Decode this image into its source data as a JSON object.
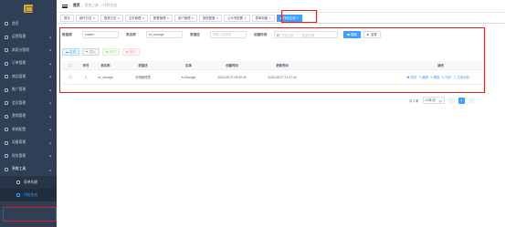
{
  "sidebar": {
    "items": [
      {
        "label": "首页",
        "expandable": false
      },
      {
        "label": "运营管理",
        "expandable": true
      },
      {
        "label": "商家分管理",
        "expandable": true
      },
      {
        "label": "订单管理",
        "expandable": true
      },
      {
        "label": "商品管理",
        "expandable": true
      },
      {
        "label": "推广管理",
        "expandable": true
      },
      {
        "label": "会员管理",
        "expandable": true
      },
      {
        "label": "营销管理",
        "expandable": true
      },
      {
        "label": "系统配置",
        "expandable": true
      },
      {
        "label": "设备管理",
        "expandable": true
      },
      {
        "label": "财务管理",
        "expandable": true
      },
      {
        "label": "系统工具",
        "expandable": true,
        "open": true
      }
    ],
    "submenu": [
      {
        "label": "表单构建",
        "active": false
      },
      {
        "label": "代码生成",
        "active": true
      }
    ]
  },
  "header": {
    "breadcrumb": [
      "首页",
      "系统工具",
      "代码生成"
    ]
  },
  "tags": [
    {
      "label": "首页",
      "active": false
    },
    {
      "label": "操作日志",
      "active": false
    },
    {
      "label": "登录日志",
      "active": false
    },
    {
      "label": "文件管理",
      "active": false
    },
    {
      "label": "配置管理",
      "active": false
    },
    {
      "label": "用户管理",
      "active": false
    },
    {
      "label": "授权配置",
      "active": false
    },
    {
      "label": "公众号配置",
      "active": false
    },
    {
      "label": "表单构建",
      "active": false
    },
    {
      "label": "代码生成",
      "active": true
    }
  ],
  "search": {
    "db_label": "数据源",
    "db_value": "master",
    "table_label": "表名称",
    "table_value": "kv_storage",
    "desc_label": "表描述",
    "desc_placeholder": "请输入表描述",
    "created_label": "创建时间",
    "start_placeholder": "开始日期",
    "range_sep": "-",
    "end_placeholder": "结束日期",
    "search_btn": "搜索",
    "reset_btn": "重置"
  },
  "toolbar": {
    "generate": "生成",
    "import": "导入",
    "edit": "修改",
    "delete": "删除"
  },
  "table": {
    "columns": [
      "序号",
      "表名称",
      "表描述",
      "实体",
      "创建时间",
      "更新时间",
      "操作"
    ],
    "rows": [
      {
        "no": "1",
        "name": "kv_storage",
        "desc": "仓储管理表",
        "class": "KvStorage",
        "created": "2023-08-27 09:50:49",
        "updated": "2023-08-27 21:47:42",
        "ops": [
          "预览",
          "编辑",
          "删除",
          "同步",
          "生成代码"
        ]
      }
    ]
  },
  "pager": {
    "total": "共 1 条",
    "size": "10条/页",
    "prev": "<",
    "page": "1",
    "next": ">"
  }
}
